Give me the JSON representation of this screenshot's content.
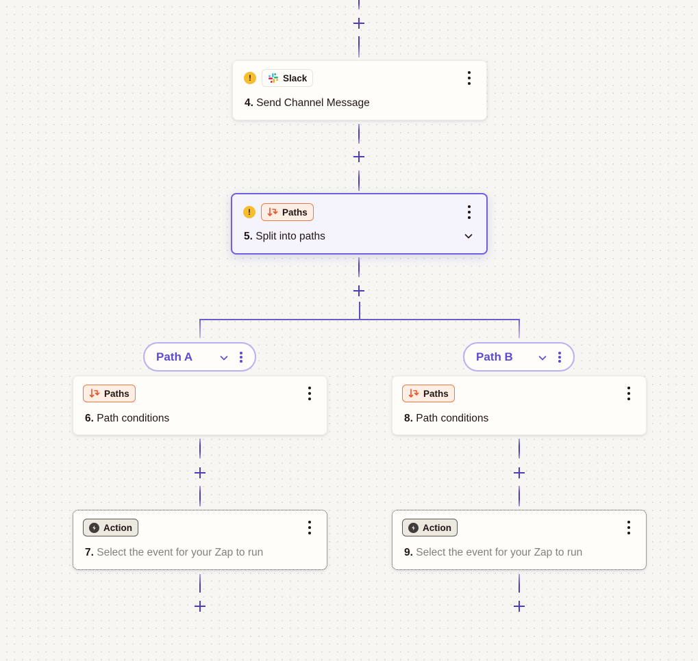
{
  "colors": {
    "accent": "#5b4bd3",
    "connector": "#4b3cc0",
    "warning": "#f5bd2f",
    "paths_orange": "#f0783f",
    "canvas_bg": "#f7f6f3"
  },
  "steps": [
    {
      "number": "4.",
      "title": "Send Channel Message",
      "badge_label": "Slack",
      "badge_icon": "slack-icon",
      "warning": true,
      "state": "default"
    },
    {
      "number": "5.",
      "title": "Split into paths",
      "badge_label": "Paths",
      "badge_icon": "paths-icon",
      "warning": true,
      "state": "selected",
      "expand_icon": "chevron-down-icon"
    },
    {
      "number": "6.",
      "title": "Path conditions",
      "badge_label": "Paths",
      "badge_icon": "paths-icon",
      "warning": false,
      "state": "default"
    },
    {
      "number": "7.",
      "title": "Select the event for your Zap to run",
      "badge_label": "Action",
      "badge_icon": "bolt-icon",
      "warning": false,
      "state": "placeholder"
    },
    {
      "number": "8.",
      "title": "Path conditions",
      "badge_label": "Paths",
      "badge_icon": "paths-icon",
      "warning": false,
      "state": "default"
    },
    {
      "number": "9.",
      "title": "Select the event for your Zap to run",
      "badge_label": "Action",
      "badge_icon": "bolt-icon",
      "warning": false,
      "state": "placeholder"
    }
  ],
  "paths": [
    {
      "label": "Path A"
    },
    {
      "label": "Path B"
    }
  ],
  "icons": {
    "warning_glyph": "!",
    "add_step": "plus-icon",
    "more_options": "kebab-menu-icon"
  }
}
